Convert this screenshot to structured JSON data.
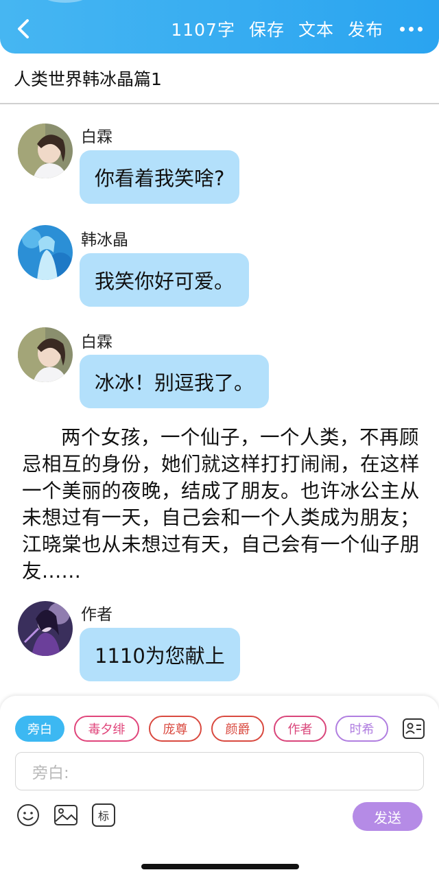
{
  "header": {
    "word_count": "1107字",
    "save": "保存",
    "text": "文本",
    "publish": "发布",
    "accent": "#3aaef2"
  },
  "story": {
    "title": "人类世界韩冰晶篇1"
  },
  "messages": [
    {
      "name": "白霖",
      "text": "你看着我笑啥?"
    },
    {
      "name": "韩冰晶",
      "text": "我笑你好可爱。"
    },
    {
      "name": "白霖",
      "text": "冰冰！别逗我了。"
    }
  ],
  "narration": "两个女孩，一个仙子，一个人类，不再顾忌相互的身份，她们就这样打打闹闹，在这样一个美丽的夜晚，结成了朋友。也许冰公主从未想过有一天，自己会和一个人类成为朋友；江晓棠也从未想过有天，自己会有一个仙子朋友......",
  "author_message": {
    "name": "作者",
    "text": "1110为您献上"
  },
  "roles": [
    {
      "label": "旁白",
      "color": "#3cb8f2"
    },
    {
      "label": "毒夕绯",
      "color": "#e0457b"
    },
    {
      "label": "庞尊",
      "color": "#d9493f"
    },
    {
      "label": "颜爵",
      "color": "#d9493f"
    },
    {
      "label": "作者",
      "color": "#d9457a"
    },
    {
      "label": "时希",
      "color": "#b07ee0"
    }
  ],
  "input": {
    "placeholder": "旁白:"
  },
  "tools": {
    "tag_label": "标"
  },
  "send": {
    "label": "发送",
    "color": "#b58be6"
  }
}
